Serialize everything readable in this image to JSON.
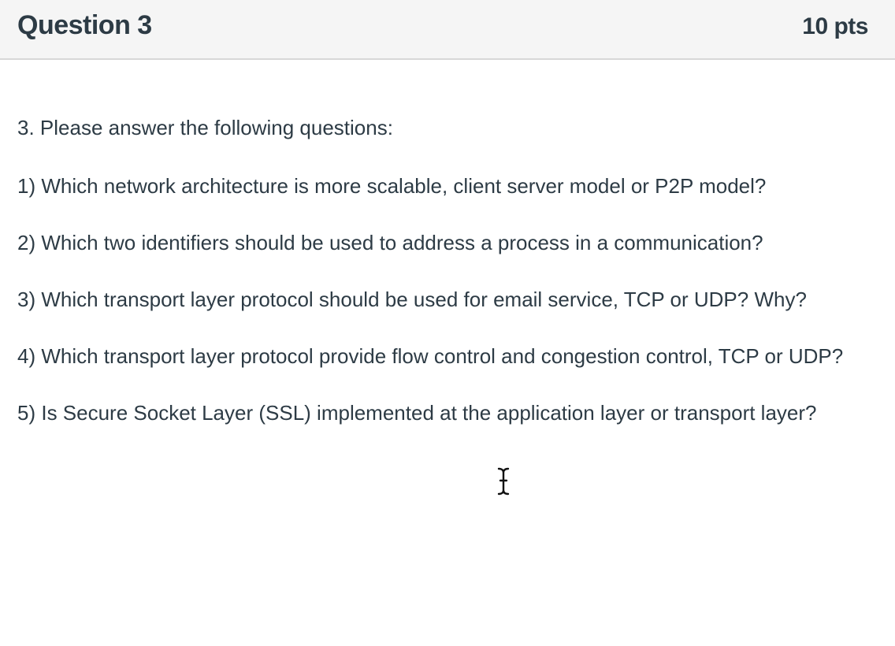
{
  "header": {
    "title": "Question 3",
    "points": "10 pts"
  },
  "question": {
    "intro": "3. Please answer the following questions:",
    "items": [
      "1) Which network architecture is more scalable, client server model or P2P model?",
      "2) Which two identifiers should be used to address a process in a communication?",
      "3) Which transport layer protocol should be used for email service, TCP or UDP? Why?",
      "4) Which transport layer protocol provide flow control and congestion control, TCP or UDP?",
      "5) Is Secure Socket Layer (SSL) implemented at the application layer or transport layer?"
    ]
  },
  "icons": {
    "cursor": "text-cursor-icon"
  },
  "colors": {
    "text": "#2d3b45",
    "header_bg": "#f5f5f5",
    "header_border": "#d7d7d7"
  }
}
